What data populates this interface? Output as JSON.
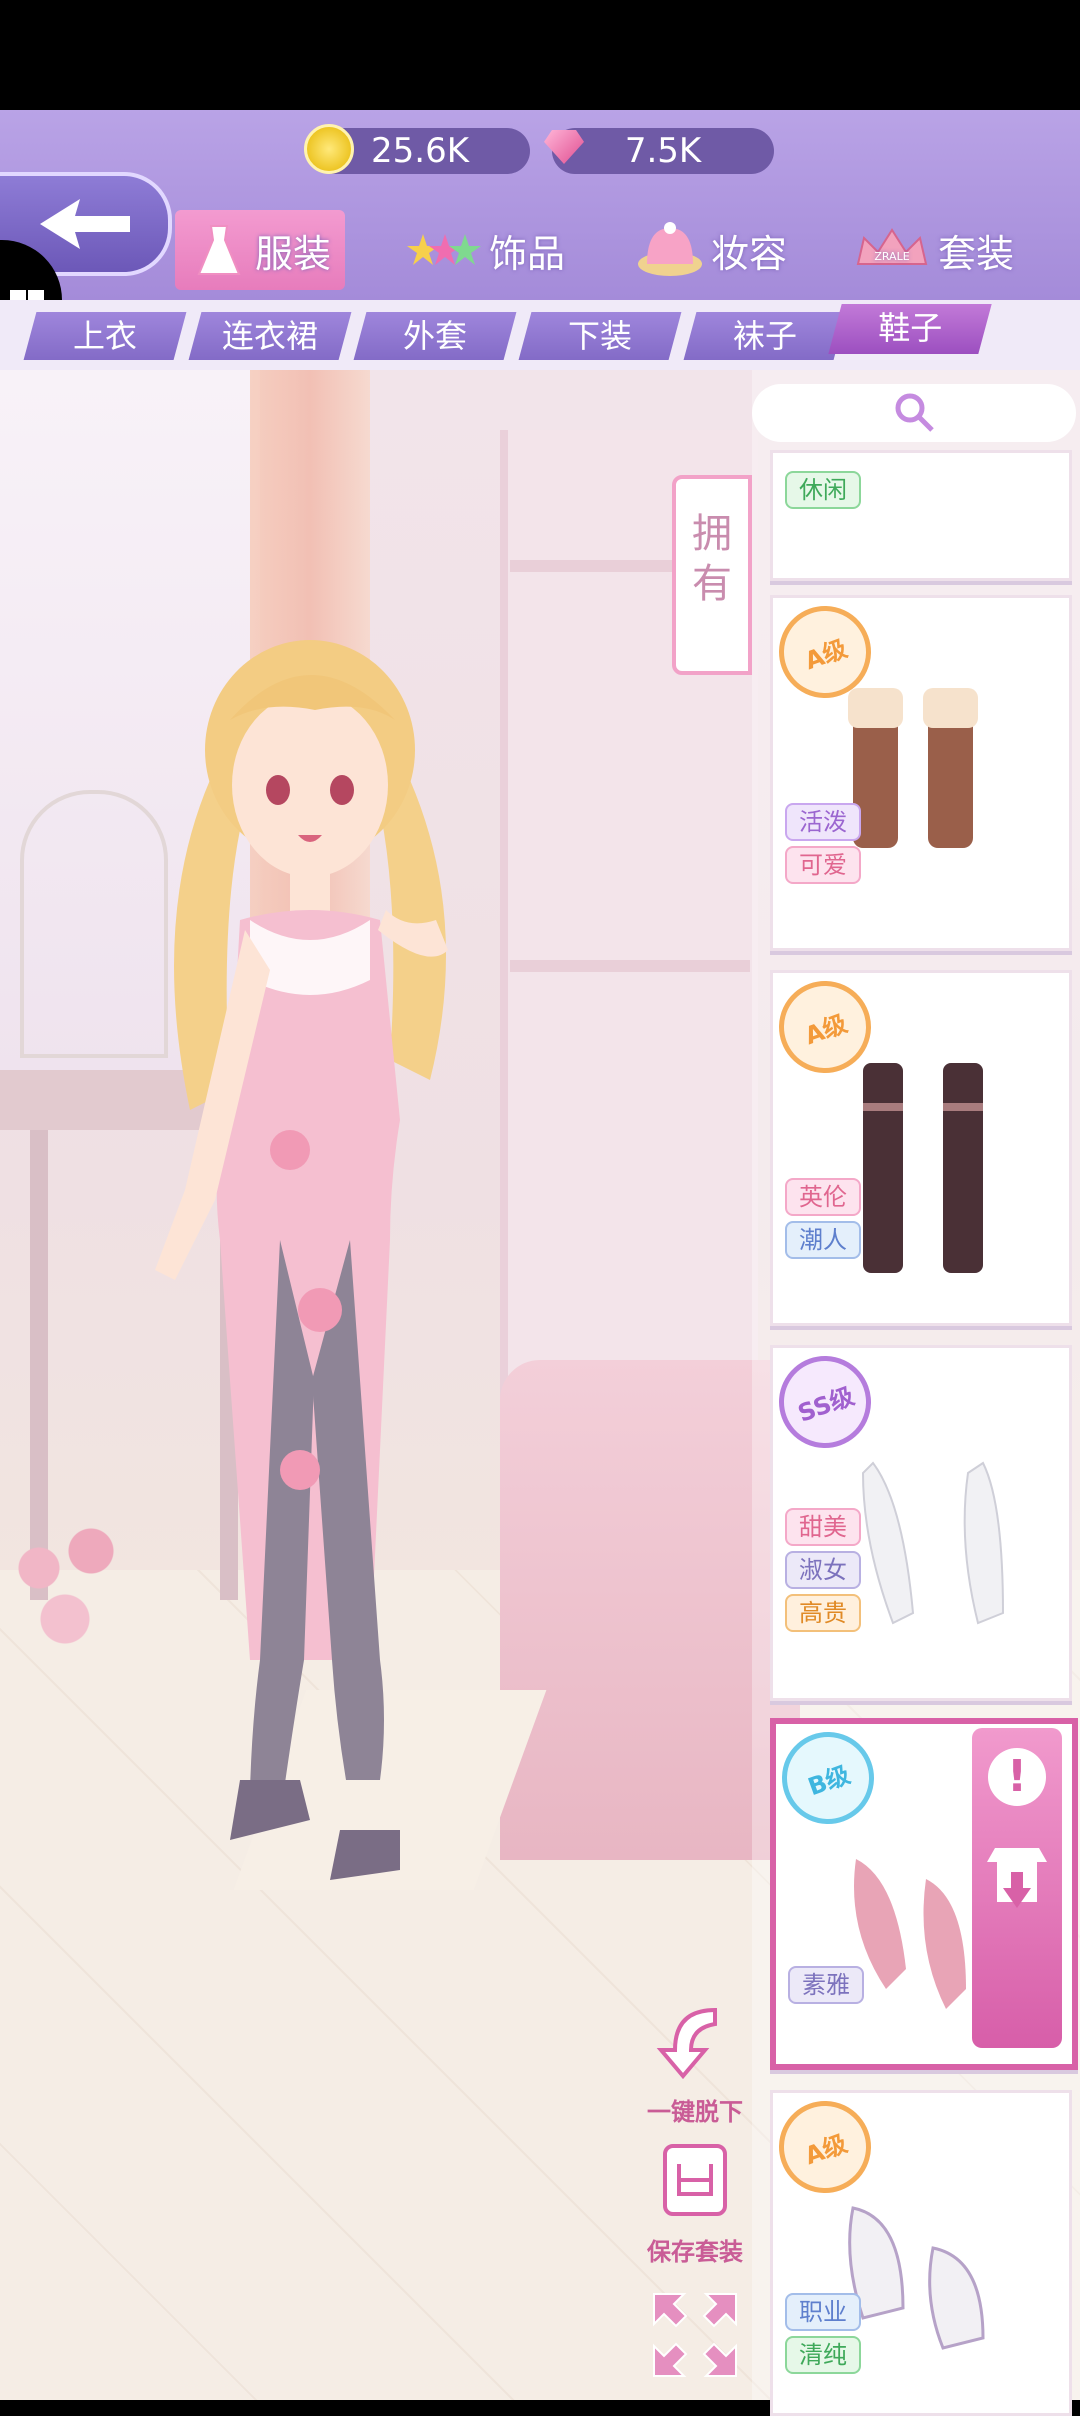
{
  "currency": {
    "coins": "25.6K",
    "diamonds": "7.5K"
  },
  "categories": [
    {
      "label": "服装",
      "icon": "dress-icon",
      "active": true
    },
    {
      "label": "饰品",
      "icon": "stars-icon",
      "active": false
    },
    {
      "label": "妆容",
      "icon": "hat-icon",
      "active": false
    },
    {
      "label": "套装",
      "icon": "crown-icon",
      "active": false
    }
  ],
  "crown_text": "ZRALE",
  "subcategories": [
    {
      "label": "上衣",
      "active": false
    },
    {
      "label": "连衣裙",
      "active": false
    },
    {
      "label": "外套",
      "active": false
    },
    {
      "label": "下装",
      "active": false
    },
    {
      "label": "袜子",
      "active": false
    },
    {
      "label": "鞋子",
      "active": true
    }
  ],
  "owned_tab": {
    "line1": "拥",
    "line2": "有"
  },
  "items": [
    {
      "grade": "",
      "tags": [
        "休闲"
      ],
      "selected": false
    },
    {
      "grade": "A级",
      "tags": [
        "活泼",
        "可爱"
      ],
      "selected": false
    },
    {
      "grade": "A级",
      "tags": [
        "英伦",
        "潮人"
      ],
      "selected": false
    },
    {
      "grade": "SS级",
      "tags": [
        "甜美",
        "淑女",
        "高贵"
      ],
      "selected": false
    },
    {
      "grade": "B级",
      "tags": [
        "素雅"
      ],
      "selected": true
    },
    {
      "grade": "A级",
      "tags": [
        "职业",
        "清纯"
      ],
      "selected": false
    }
  ],
  "actions": {
    "undress": "一键脱下",
    "save_outfit": "保存套装"
  },
  "colors": {
    "accent_purple": "#a48bd9",
    "accent_pink": "#d861a7"
  }
}
